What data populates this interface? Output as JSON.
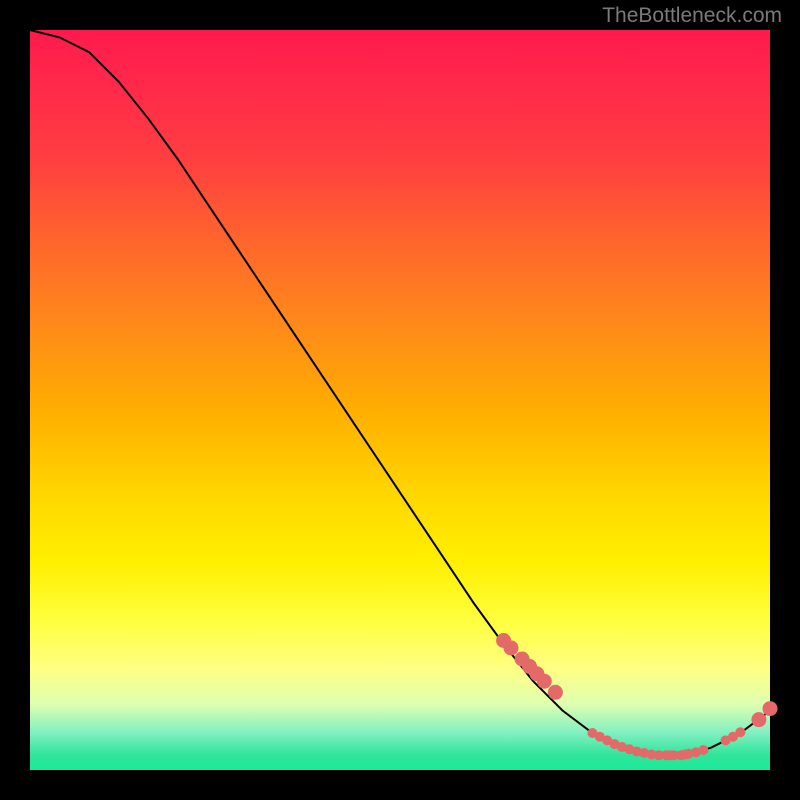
{
  "watermark": "TheBottleneck.com",
  "chart_data": {
    "type": "line",
    "title": "",
    "xlabel": "",
    "ylabel": "",
    "xlim": [
      0,
      100
    ],
    "ylim": [
      0,
      100
    ],
    "curve": {
      "x": [
        0,
        4,
        8,
        12,
        16,
        20,
        24,
        28,
        32,
        36,
        40,
        44,
        48,
        52,
        56,
        60,
        64,
        68,
        72,
        76,
        80,
        84,
        88,
        92,
        96,
        100
      ],
      "y": [
        100,
        99,
        97,
        93,
        88,
        82.5,
        76.5,
        70.5,
        64.5,
        58.5,
        52.5,
        46.5,
        40.5,
        34.5,
        28.5,
        22.5,
        17,
        12,
        8,
        5,
        3,
        2,
        2,
        3,
        5,
        8
      ]
    },
    "markers_large": {
      "x": [
        64,
        65,
        66.5,
        67.5,
        68.5,
        69.5,
        71,
        98.5,
        100
      ],
      "y": [
        17.5,
        16.5,
        15,
        14,
        13,
        12,
        10.5,
        6.8,
        8.3
      ]
    },
    "markers_small": {
      "x": [
        76,
        77,
        78,
        79,
        80,
        81,
        82,
        83,
        84,
        85,
        86,
        86.5,
        87,
        88,
        88.5,
        89,
        90,
        91,
        94,
        95,
        96
      ],
      "y": [
        5.0,
        4.5,
        4.0,
        3.5,
        3.1,
        2.8,
        2.5,
        2.3,
        2.1,
        2.0,
        2.0,
        2.0,
        2.0,
        2.0,
        2.1,
        2.2,
        2.4,
        2.7,
        4.0,
        4.5,
        5.1
      ]
    },
    "marker_color": "#e46a6a",
    "line_color": "#000000"
  }
}
